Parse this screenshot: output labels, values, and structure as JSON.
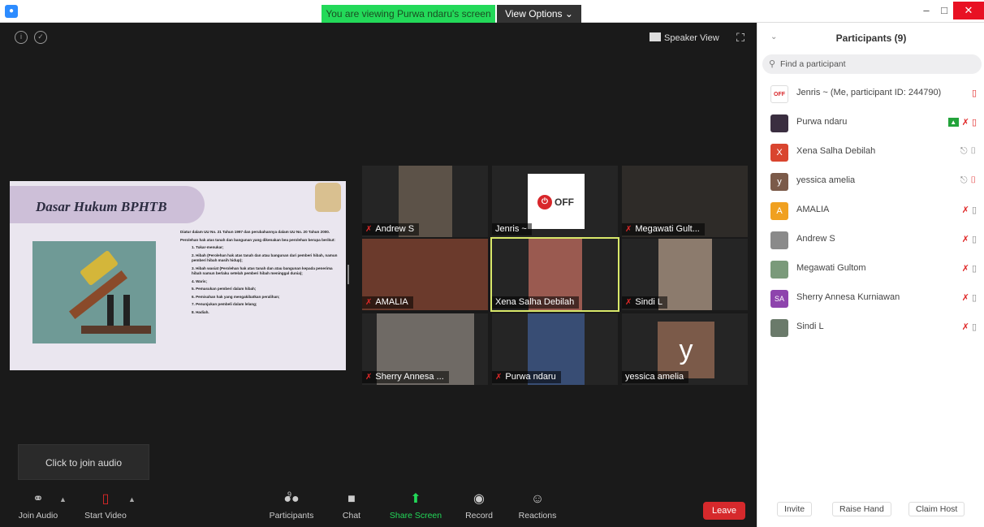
{
  "titlebar": {
    "sharing_banner": "You are viewing Purwa ndaru's screen",
    "view_options": "View Options ⌄",
    "minimize": "–",
    "maximize": "□",
    "close": "✕"
  },
  "main": {
    "info_icon": "i",
    "shield_icon": "✓",
    "speaker_view_label": "Speaker View",
    "fullscreen_icon": "⛶"
  },
  "slide": {
    "title": "Dasar Hukum BPHTB",
    "text_lines": [
      "Diatur dalam UU No. 21 Tahun 1997 dan perubahannya dalam UU No. 20 Tahun 2000.",
      "Perolehan hak atas tanah dan bangunan yang dikenakan bea perolehan berupa berikut:",
      "1. Tukar-menukar;",
      "2. Hibah (Perolehan hak atas tanah dan atau bangunan dari pemberi hibah, namun pemberi hibah masih hidup);",
      "3. Hibah wasiat (Perolehan hak atas tanah dan atau bangunan kepada penerima hibah namun berlaku setelah pemberi hibah meninggal dunia);",
      "4. Waris;",
      "5. Pemasukan pemberi dalam hibah;",
      "6. Pemisahan hak yang mengakibatkan peralihan;",
      "7. Penunjukan pembeli dalam lelang;",
      "8. Hadiah."
    ]
  },
  "tiles": [
    {
      "name": "Andrew S",
      "muted": true,
      "video_color": "#5c5248"
    },
    {
      "name": "Jenris ~",
      "muted": false,
      "off_button": "OFF"
    },
    {
      "name": "Megawati Gult...",
      "muted": true,
      "video_color": "#2e2b28"
    },
    {
      "name": "AMALIA",
      "muted": true,
      "video_color": "#6b3a2c"
    },
    {
      "name": "Xena Salha Debilah",
      "muted": false,
      "video_color": "#9a5a50",
      "active": true
    },
    {
      "name": "Sindi L",
      "muted": true,
      "video_color": "#8c7b6d"
    },
    {
      "name": "Sherry Annesa ...",
      "muted": true,
      "video_color": "#6f6a65"
    },
    {
      "name": "Purwa ndaru",
      "muted": true,
      "video_color": "#384d74"
    },
    {
      "name": "yessica amelia",
      "muted": false,
      "avatar_letter": "y"
    }
  ],
  "audio_tooltip": "Click to join audio",
  "toolbar": {
    "join_audio": "Join Audio",
    "start_video": "Start Video",
    "participants": "Participants",
    "participants_count": "9",
    "chat": "Chat",
    "share_screen": "Share Screen",
    "record": "Record",
    "reactions": "Reactions",
    "leave": "Leave"
  },
  "panel": {
    "title": "Participants (9)",
    "search_placeholder": "Find a participant",
    "participants": [
      {
        "name": "Jenris ~ (Me, participant ID: 244790)",
        "avatar": "OFF",
        "avatar_color": "#ffffff",
        "icons": "video-off",
        "mic": ""
      },
      {
        "name": "Purwa ndaru",
        "avatar": "",
        "avatar_color": "#3a2e40",
        "icons": "share mic-off video-off",
        "mic": ""
      },
      {
        "name": "Xena Salha Debilah",
        "avatar": "X",
        "avatar_color": "#d9452f",
        "icons": "mic video",
        "mic": ""
      },
      {
        "name": "yessica amelia",
        "avatar": "y",
        "avatar_color": "#7b5a49",
        "icons": "mic video-off",
        "mic": ""
      },
      {
        "name": "AMALIA",
        "avatar": "A",
        "avatar_color": "#f0a020",
        "icons": "mic-off video",
        "mic": ""
      },
      {
        "name": "Andrew S",
        "avatar": "",
        "avatar_color": "#8a8a8a",
        "icons": "mic-off video",
        "mic": ""
      },
      {
        "name": "Megawati Gultom",
        "avatar": "",
        "avatar_color": "#7a9a7a",
        "icons": "mic-off video",
        "mic": ""
      },
      {
        "name": "Sherry Annesa Kurniawan",
        "avatar": "SA",
        "avatar_color": "#8e44ad",
        "icons": "mic-off video",
        "mic": ""
      },
      {
        "name": "Sindi L",
        "avatar": "",
        "avatar_color": "#6a7a6a",
        "icons": "mic-off video",
        "mic": ""
      }
    ],
    "invite": "Invite",
    "raise_hand": "Raise Hand",
    "claim_host": "Claim Host"
  }
}
